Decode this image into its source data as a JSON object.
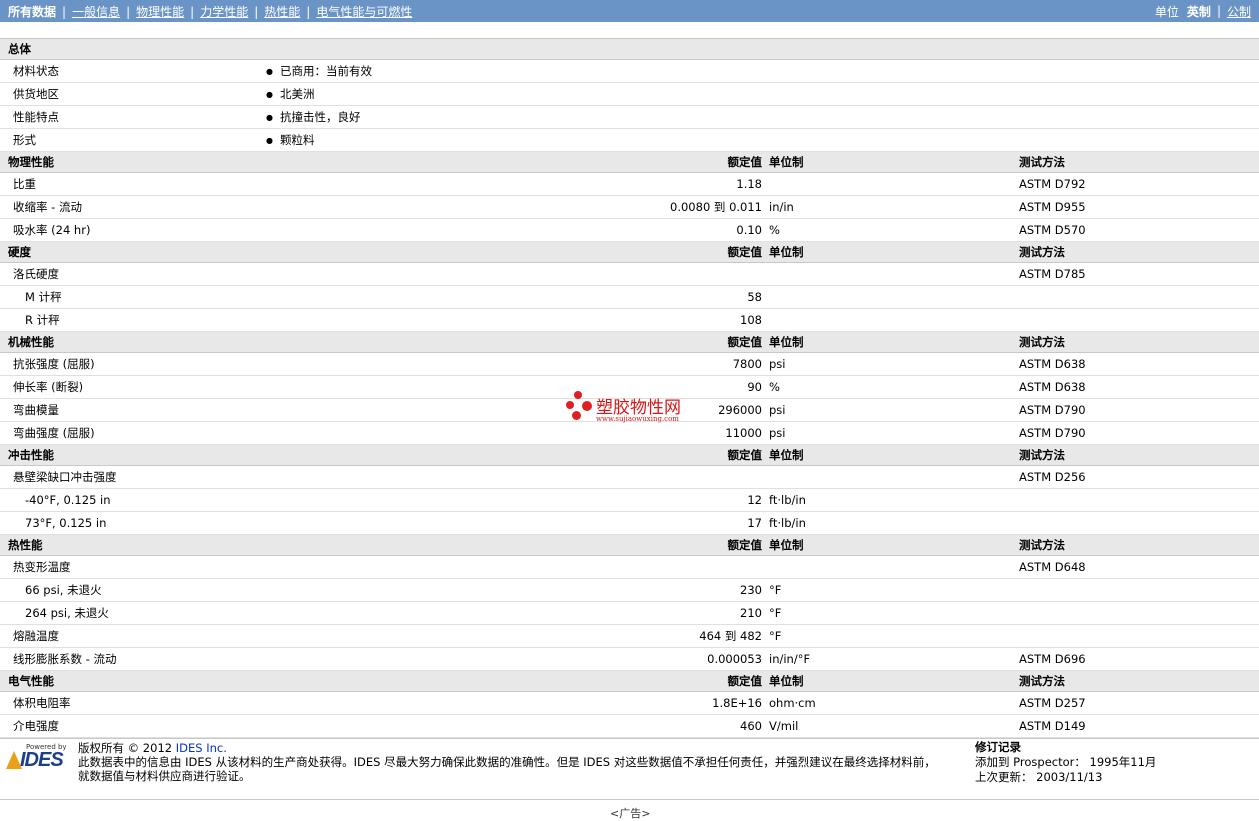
{
  "nav": {
    "items": [
      "所有数据",
      "一般信息",
      "物理性能",
      "力学性能",
      "热性能",
      "电气性能与可燃性"
    ],
    "units_label": "单位",
    "unit_english": "英制",
    "unit_metric": "公制"
  },
  "headers": {
    "nominal": "额定值",
    "unit": "单位制",
    "method": "测试方法"
  },
  "general": {
    "title": "总体",
    "rows": [
      {
        "label": "材料状态",
        "value": "已商用：当前有效"
      },
      {
        "label": "供货地区",
        "value": "北美洲"
      },
      {
        "label": "性能特点",
        "value": "抗撞击性，良好"
      },
      {
        "label": "形式",
        "value": "颗粒料"
      }
    ]
  },
  "sections": [
    {
      "title": "物理性能",
      "rows": [
        {
          "label": "比重",
          "value": "1.18",
          "unit": "",
          "method": "ASTM D792",
          "indent": 1
        },
        {
          "label": "收缩率 - 流动",
          "value": "0.0080 到  0.011",
          "unit": "in/in",
          "method": "ASTM D955",
          "indent": 1
        },
        {
          "label": "吸水率 (24 hr)",
          "value": "0.10",
          "unit": "%",
          "method": "ASTM D570",
          "indent": 1
        }
      ]
    },
    {
      "title": "硬度",
      "rows": [
        {
          "label": "洛氏硬度",
          "value": "",
          "unit": "",
          "method": "ASTM D785",
          "indent": 1
        },
        {
          "label": "M 计秤",
          "value": "58",
          "unit": "",
          "method": "",
          "indent": 2
        },
        {
          "label": "R 计秤",
          "value": "108",
          "unit": "",
          "method": "",
          "indent": 2
        }
      ]
    },
    {
      "title": "机械性能",
      "rows": [
        {
          "label": "抗张强度 (屈服)",
          "value": "7800",
          "unit": "psi",
          "method": "ASTM D638",
          "indent": 1
        },
        {
          "label": "伸长率 (断裂)",
          "value": "90",
          "unit": "%",
          "method": "ASTM D638",
          "indent": 1
        },
        {
          "label": "弯曲模量",
          "value": "296000",
          "unit": "psi",
          "method": "ASTM D790",
          "indent": 1
        },
        {
          "label": "弯曲强度 (屈服)",
          "value": "11000",
          "unit": "psi",
          "method": "ASTM D790",
          "indent": 1
        }
      ]
    },
    {
      "title": "冲击性能",
      "rows": [
        {
          "label": "悬壁梁缺口冲击强度",
          "value": "",
          "unit": "",
          "method": "ASTM D256",
          "indent": 1
        },
        {
          "label": "-40°F, 0.125 in",
          "value": "12",
          "unit": "ft·lb/in",
          "method": "",
          "indent": 2
        },
        {
          "label": "73°F, 0.125 in",
          "value": "17",
          "unit": "ft·lb/in",
          "method": "",
          "indent": 2
        }
      ]
    },
    {
      "title": "热性能",
      "rows": [
        {
          "label": "热变形温度",
          "value": "",
          "unit": "",
          "method": "ASTM D648",
          "indent": 1
        },
        {
          "label": "66 psi, 未退火",
          "value": "230",
          "unit": "°F",
          "method": "",
          "indent": 2
        },
        {
          "label": "264 psi, 未退火",
          "value": "210",
          "unit": "°F",
          "method": "",
          "indent": 2
        },
        {
          "label": "熔融温度",
          "value": "464 到  482",
          "unit": "°F",
          "method": "",
          "indent": 1
        },
        {
          "label": "线形膨胀系数 - 流动",
          "value": "0.000053",
          "unit": "in/in/°F",
          "method": "ASTM D696",
          "indent": 1
        }
      ]
    },
    {
      "title": "电气性能",
      "rows": [
        {
          "label": "体积电阻率",
          "value": "1.8E+16",
          "unit": "ohm·cm",
          "method": "ASTM D257",
          "indent": 1
        },
        {
          "label": "介电强度",
          "value": "460",
          "unit": "V/mil",
          "method": "ASTM D149",
          "indent": 1
        }
      ]
    }
  ],
  "watermark": {
    "text": "塑胶物性网",
    "url": "www.sujiaowuxing.com"
  },
  "footer": {
    "powered_by": "Powered by",
    "logo_text": "IDES",
    "copyright_prefix": "版权所有  © 2012",
    "company_link": "IDES Inc.",
    "disclaimer_1": "此数据表中的信息由  IDES 从该材料的生产商处获得。IDES 尽最大努力确保此数据的准确性。但是  IDES 对这些数据值不承担任何责任，并强烈建议在最终选择材料前，",
    "disclaimer_2": "就数据值与材料供应商进行验证。",
    "revision_title": "修订记录",
    "added_to": "添加到  Prospector：  1995年11月",
    "last_update": "上次更新：  2003/11/13",
    "ad": "<广告>"
  }
}
